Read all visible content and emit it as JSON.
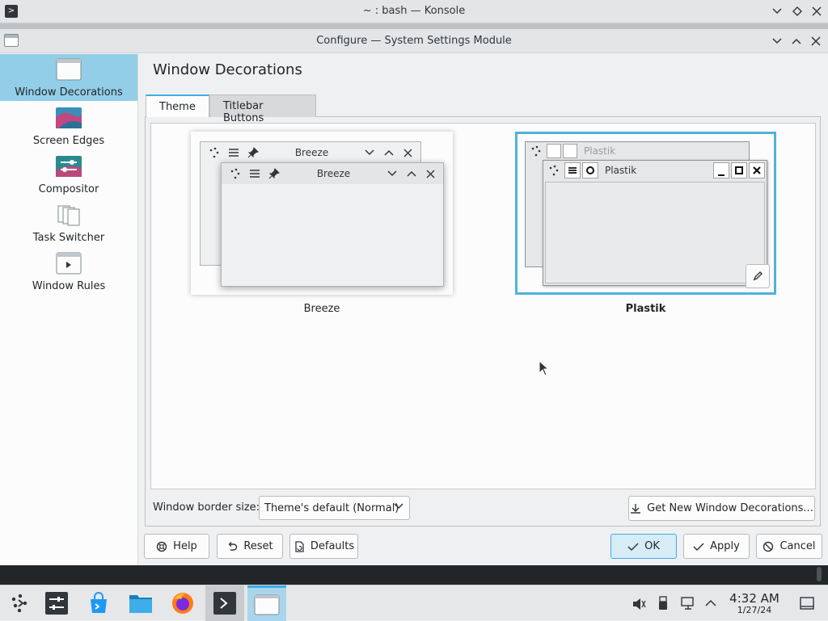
{
  "konsole": {
    "title": "~ : bash — Konsole"
  },
  "dialog": {
    "title": "Configure — System Settings Module"
  },
  "sidebar": {
    "items": [
      {
        "label": "Window Decorations",
        "icon": "window-decorations-icon",
        "active": true
      },
      {
        "label": "Screen Edges",
        "icon": "screen-edges-icon",
        "active": false
      },
      {
        "label": "Compositor",
        "icon": "compositor-icon",
        "active": false
      },
      {
        "label": "Task Switcher",
        "icon": "task-switcher-icon",
        "active": false
      },
      {
        "label": "Window Rules",
        "icon": "window-rules-icon",
        "active": false
      }
    ]
  },
  "main": {
    "title": "Window Decorations",
    "tabs": [
      {
        "label": "Theme",
        "selected": true
      },
      {
        "label": "Titlebar Buttons",
        "selected": false
      }
    ],
    "themes": [
      {
        "name": "Breeze",
        "preview_title": "Breeze",
        "selected": false
      },
      {
        "name": "Plastik",
        "preview_title": "Plastik",
        "selected": true
      }
    ],
    "border_size_label": "Window border size:",
    "border_size_value": "Theme's default (Normal)",
    "get_new_label": "Get New Window Decorations..."
  },
  "buttons": {
    "help": "Help",
    "reset": "Reset",
    "defaults": "Defaults",
    "ok": "OK",
    "apply": "Apply",
    "cancel": "Cancel"
  },
  "taskbar": {
    "apps": [
      "application-launcher-icon",
      "system-settings-icon",
      "discover-icon",
      "dolphin-icon",
      "firefox-icon",
      "konsole-icon",
      "window-icon"
    ],
    "time": "4:32 AM",
    "date": "1/27/24"
  },
  "colors": {
    "accent": "#3daee9",
    "selection": "#93cee9"
  }
}
